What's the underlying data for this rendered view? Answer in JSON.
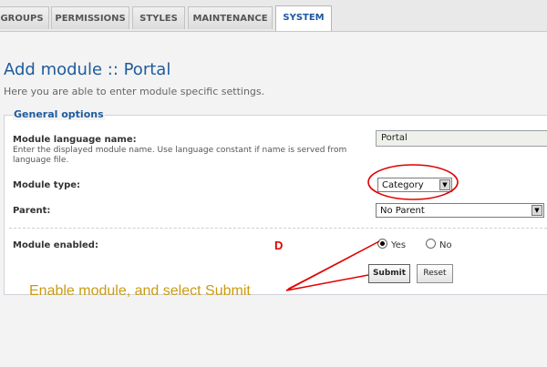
{
  "tabs": [
    {
      "label": "GROUPS"
    },
    {
      "label": "PERMISSIONS"
    },
    {
      "label": "STYLES"
    },
    {
      "label": "MAINTENANCE"
    },
    {
      "label": "SYSTEM"
    }
  ],
  "page": {
    "title": "Add module :: Portal",
    "subtitle": "Here you are able to enter module specific settings."
  },
  "general_options": {
    "legend": "General options",
    "language_name": {
      "label": "Module language name:",
      "hint": "Enter the displayed module name. Use language constant if name is served from language file.",
      "value": "Portal"
    },
    "module_type": {
      "label": "Module type:",
      "value": "Category"
    },
    "parent": {
      "label": "Parent:",
      "value": "No Parent"
    },
    "module_enabled": {
      "label": "Module enabled:",
      "yes_label": "Yes",
      "no_label": "No"
    }
  },
  "buttons": {
    "submit": "Submit",
    "reset": "Reset"
  },
  "annotations": {
    "caption": "Enable module, and select Submit",
    "marker": "D",
    "color_caption": "#c99b11",
    "color_marker": "#e00000"
  }
}
